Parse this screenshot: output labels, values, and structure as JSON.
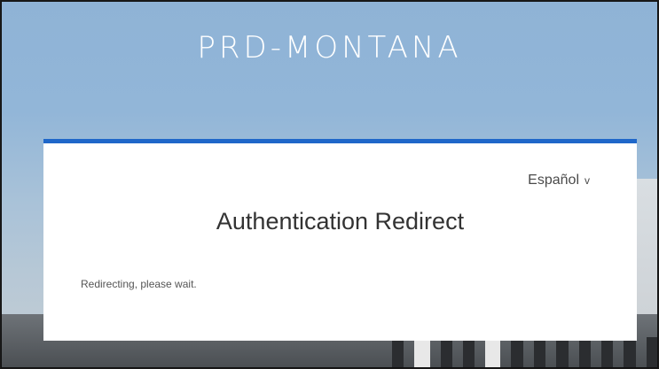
{
  "header": {
    "brand": "PRD-MONTANA"
  },
  "card": {
    "language_label": "Español",
    "language_icon": "chevron-down-icon",
    "title": "Authentication Redirect",
    "message": "Redirecting, please wait.",
    "accent_color": "#1f67c9"
  }
}
